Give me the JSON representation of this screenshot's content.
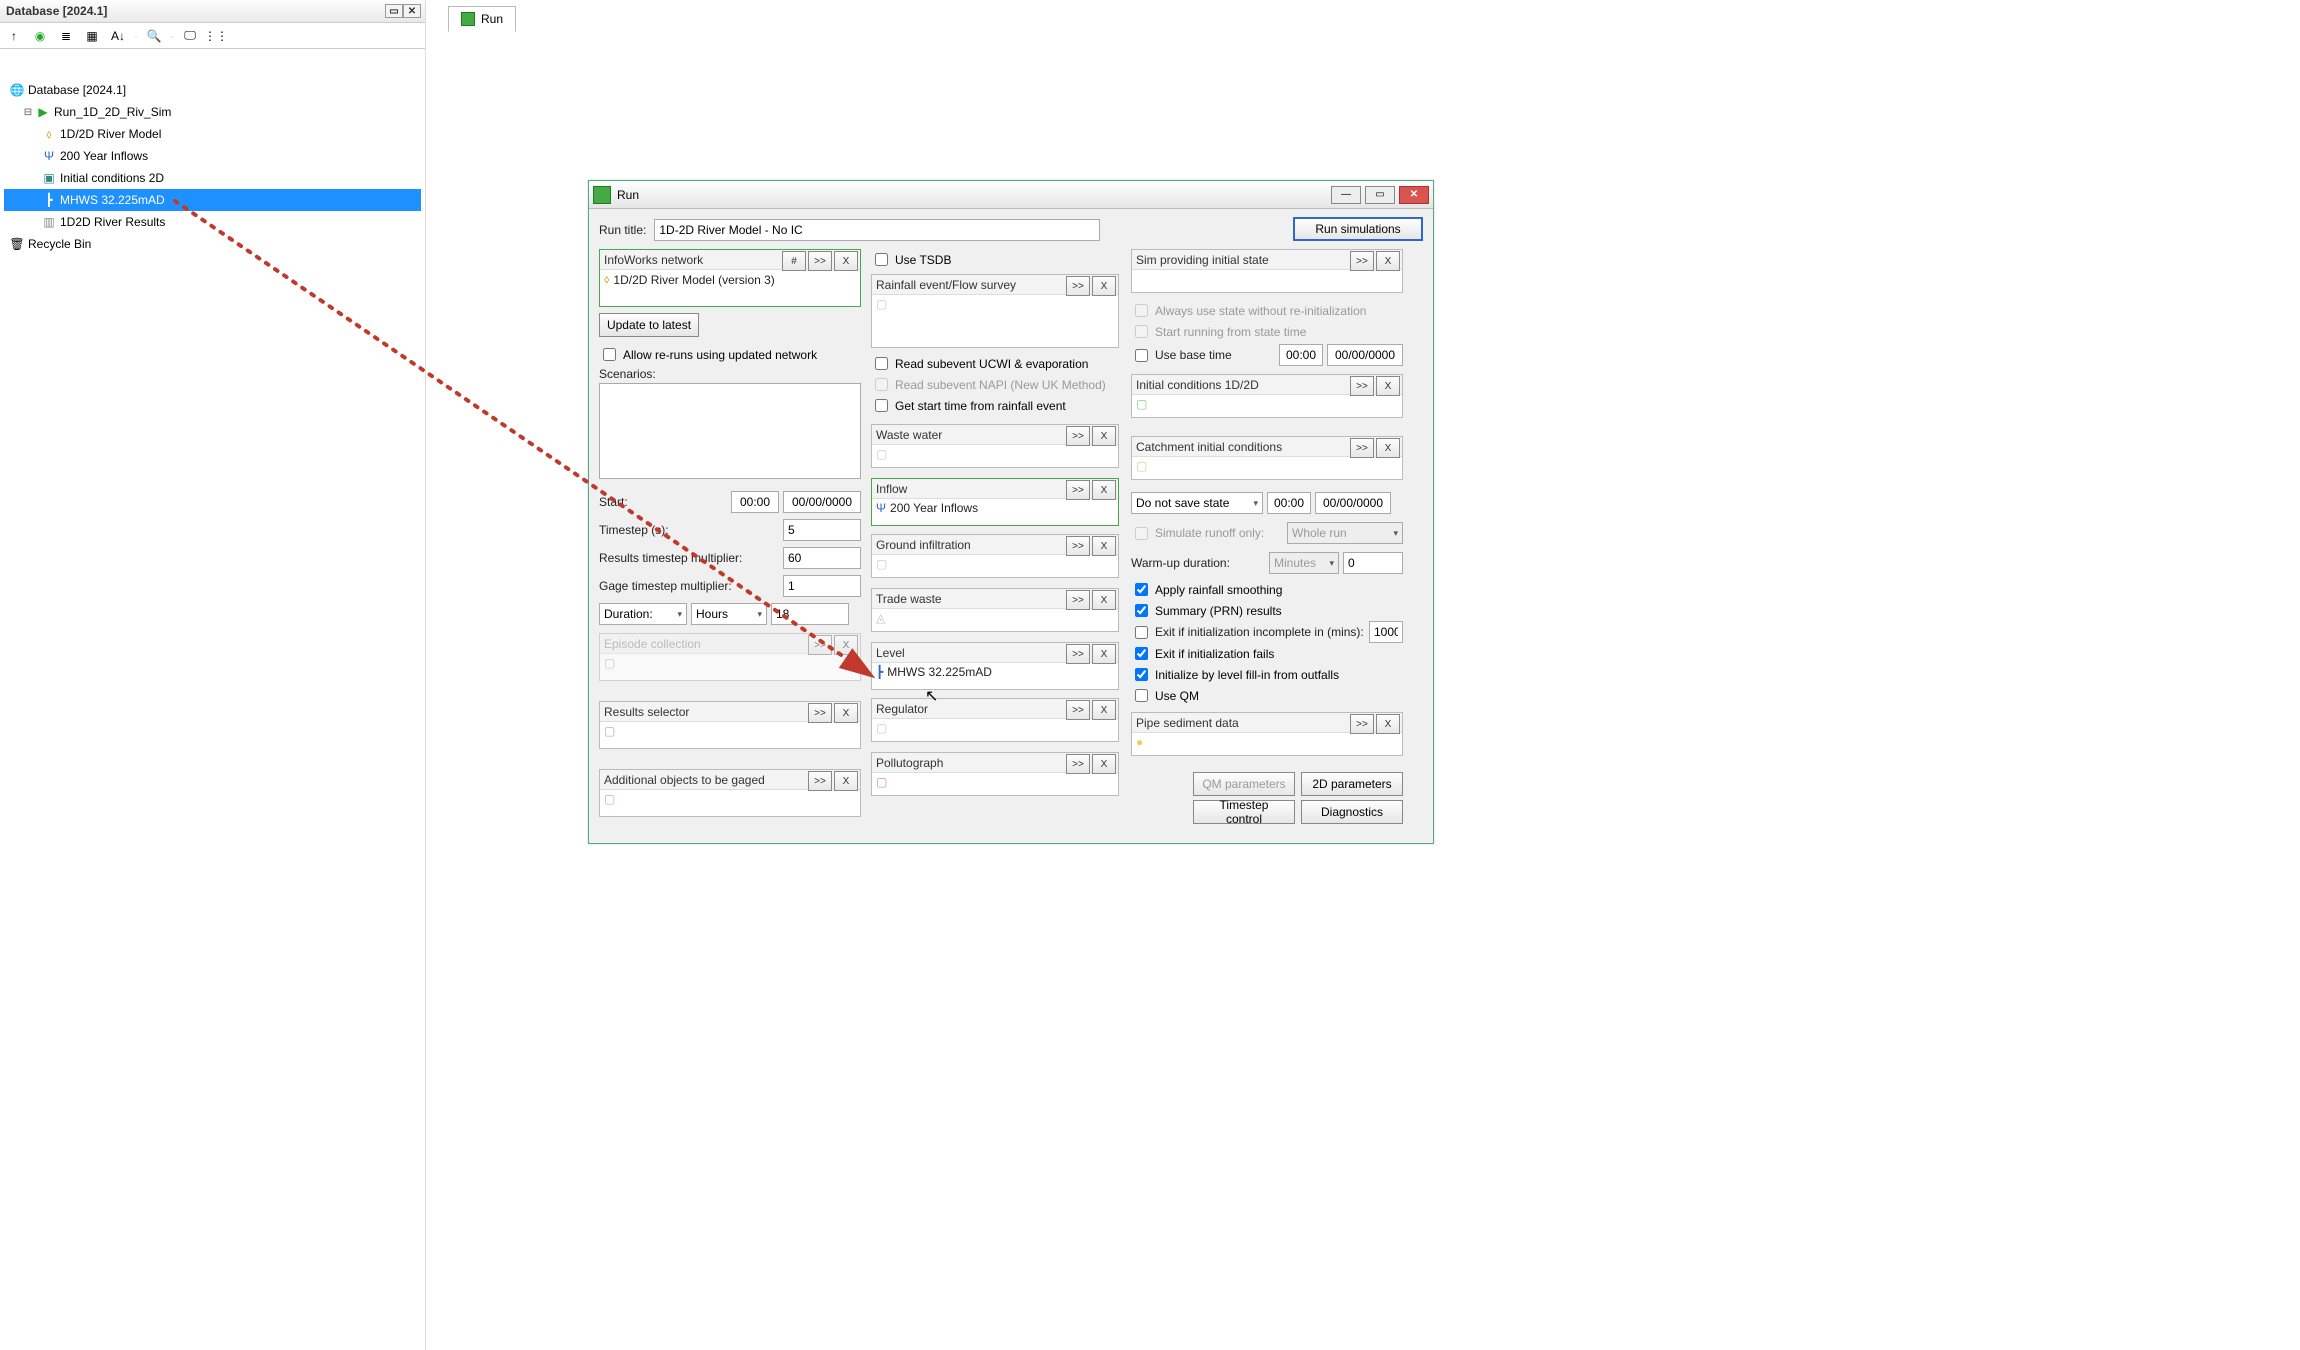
{
  "db_panel": {
    "title": "Database [2024.1]",
    "tree": {
      "root": "Database [2024.1]",
      "run_group": "Run_1D_2D_Riv_Sim",
      "items": [
        "1D/2D River Model",
        "200 Year Inflows",
        "Initial conditions 2D",
        "MHWS 32.225mAD",
        "1D2D River Results"
      ],
      "recycle": "Recycle Bin"
    }
  },
  "main_tab": "Run",
  "run_dialog": {
    "title": "Run",
    "run_title_label": "Run title:",
    "run_title_value": "1D-2D River Model - No IC",
    "run_sim_btn": "Run simulations",
    "infoworks": {
      "header": "InfoWorks network",
      "body": "1D/2D River Model (version 3)"
    },
    "update_btn": "Update to latest",
    "allow_reruns": "Allow re-runs using updated network",
    "scenarios_label": "Scenarios:",
    "start_label": "Start:",
    "start_time": "00:00",
    "start_date": "00/00/0000",
    "timestep_label": "Timestep (s):",
    "timestep_val": "5",
    "results_mult_label": "Results timestep multiplier:",
    "results_mult_val": "60",
    "gage_mult_label": "Gage timestep multiplier:",
    "gage_mult_val": "1",
    "duration_label": "Duration:",
    "duration_unit": "Hours",
    "duration_val": "18",
    "episode_header": "Episode collection",
    "results_selector_header": "Results selector",
    "additional_header": "Additional objects to be gaged",
    "use_tsdb": "Use TSDB",
    "rainfall_header": "Rainfall event/Flow survey",
    "read_ucwi": "Read subevent UCWI & evaporation",
    "read_napi": "Read subevent NAPI (New UK Method)",
    "get_start": "Get start time from rainfall event",
    "waste_water_header": "Waste water",
    "inflow_header": "Inflow",
    "inflow_body": "200 Year Inflows",
    "ground_infil_header": "Ground infiltration",
    "trade_waste_header": "Trade waste",
    "level_header": "Level",
    "level_body": "MHWS 32.225mAD",
    "regulator_header": "Regulator",
    "pollutograph_header": "Pollutograph",
    "sim_state_header": "Sim providing initial state",
    "always_state": "Always use state without re-initialization",
    "start_state_time": "Start running from state time",
    "use_base_time": "Use base time",
    "base_time": "00:00",
    "base_date": "00/00/0000",
    "initial_cond_header": "Initial conditions 1D/2D",
    "catchment_header": "Catchment initial conditions",
    "save_state_sel": "Do not save state",
    "save_state_time": "00:00",
    "save_state_date": "00/00/0000",
    "sim_runoff_only": "Simulate runoff only:",
    "whole_run": "Whole run",
    "warmup_label": "Warm-up duration:",
    "warmup_unit": "Minutes",
    "warmup_val": "0",
    "apply_rainfall": "Apply rainfall smoothing",
    "summary_prn": "Summary (PRN) results",
    "exit_incomplete": "Exit if initialization incomplete in (mins):",
    "exit_incomplete_val": "1000",
    "exit_fails": "Exit if initialization fails",
    "init_level_fillin": "Initialize by level fill-in from outfalls",
    "use_qm": "Use QM",
    "pipe_sediment_header": "Pipe sediment data",
    "qm_params_btn": "QM parameters",
    "twod_params_btn": "2D parameters",
    "timestep_ctrl_btn": "Timestep control",
    "diagnostics_btn": "Diagnostics",
    "hash_btn": "#",
    "expand_btn": ">>",
    "clear_btn": "X"
  }
}
